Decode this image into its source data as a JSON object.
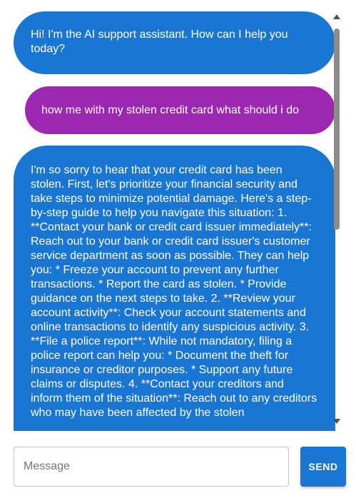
{
  "messages": [
    {
      "role": "assistant",
      "text": "Hi! I'm the AI support assistant. How can I help you today?"
    },
    {
      "role": "user",
      "text": "how me with my stolen credit card what should i do"
    },
    {
      "role": "assistant",
      "text": "I'm so sorry to hear that your credit card has been stolen. First, let's prioritize your financial security and take steps to minimize potential damage. Here's a step-by-step guide to help you navigate this situation: 1. **Contact your bank or credit card issuer immediately**: Reach out to your bank or credit card issuer's customer service department as soon as possible. They can help you: * Freeze your account to prevent any further transactions. * Report the card as stolen. * Provide guidance on the next steps to take. 2. **Review your account activity**: Check your account statements and online transactions to identify any suspicious activity. 3. **File a police report**: While not mandatory, filing a police report can help you: * Document the theft for insurance or creditor purposes. * Support any future claims or disputes. 4. **Contact your creditors and inform them of the situation**: Reach out to any creditors who may have been affected by the stolen"
    }
  ],
  "input": {
    "placeholder": "Message",
    "value": ""
  },
  "send_label": "SEND",
  "colors": {
    "assistant_bubble": "#1976d2",
    "user_bubble": "#9c27b0",
    "send_button": "#1976d2"
  }
}
